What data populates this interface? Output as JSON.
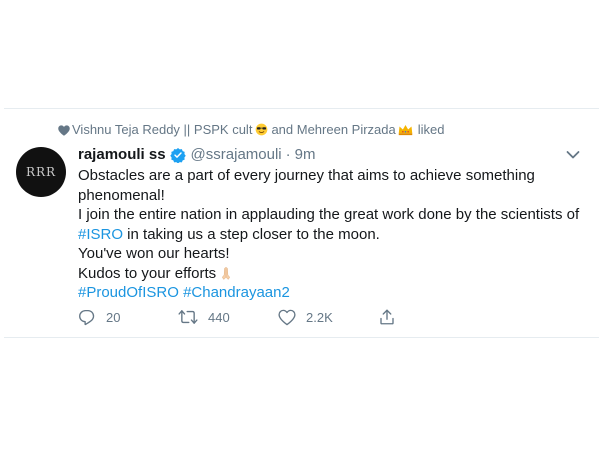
{
  "social_context": {
    "text_prefix": "Vishnu Teja Reddy || PSPK cult",
    "emoji1_icon": "smiling-face-with-sunglasses",
    "middle": "and Mehreen Pirzada",
    "emoji2_icon": "crown",
    "suffix": "liked"
  },
  "tweet": {
    "avatar_text": "RRR",
    "display_name": "rajamouli ss",
    "handle": "@ssrajamouli",
    "separator": "·",
    "time": "9m",
    "body": {
      "line1": "Obstacles are a part of every journey that aims to achieve something",
      "line2": "phenomenal!",
      "line3": "I join the entire nation in applauding the great work done by the scientists of",
      "line4_hashtag": "#ISRO",
      "line4_rest": " in taking us a step closer to the moon.",
      "line5": "You've won our hearts!",
      "line6": "Kudos to your efforts",
      "line6_emoji_icon": "folded-hands",
      "hashtag1": "#ProudOfISRO",
      "hashtag2": "#Chandrayaan2"
    },
    "actions": {
      "reply_count": "20",
      "retweet_count": "440",
      "like_count": "2.2K"
    }
  },
  "colors": {
    "link": "#1b95e0",
    "secondary_text": "#657786",
    "verified": "#1da1f2"
  }
}
